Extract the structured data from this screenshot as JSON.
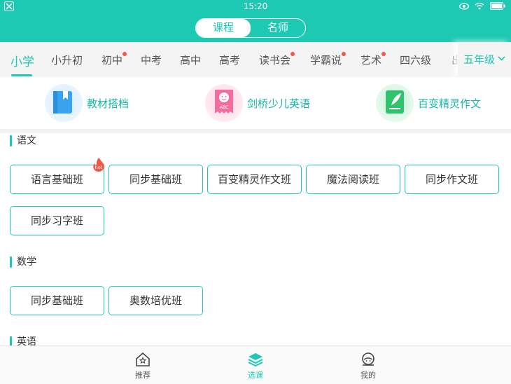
{
  "status": {
    "time": "15:20"
  },
  "header": {
    "segments": [
      {
        "label": "课程",
        "active": true
      },
      {
        "label": "名师",
        "active": false
      }
    ]
  },
  "levels": {
    "items": [
      {
        "label": "小学",
        "active": true,
        "dot": false
      },
      {
        "label": "小升初",
        "active": false,
        "dot": false
      },
      {
        "label": "初中",
        "active": false,
        "dot": true
      },
      {
        "label": "中考",
        "active": false,
        "dot": false
      },
      {
        "label": "高中",
        "active": false,
        "dot": false
      },
      {
        "label": "高考",
        "active": false,
        "dot": false
      },
      {
        "label": "读书会",
        "active": false,
        "dot": true
      },
      {
        "label": "学霸说",
        "active": false,
        "dot": true
      },
      {
        "label": "艺术",
        "active": false,
        "dot": true
      },
      {
        "label": "四六级",
        "active": false,
        "dot": false
      },
      {
        "label": "出",
        "active": false,
        "dot": false
      }
    ],
    "grade": "五年级"
  },
  "features": [
    {
      "label": "教材搭档",
      "icon": "book-icon"
    },
    {
      "label": "剑桥少儿英语",
      "icon": "abc-icon"
    },
    {
      "label": "百变精灵作文",
      "icon": "notebook-icon"
    }
  ],
  "sections": [
    {
      "title": "语文",
      "courses": [
        "语言基础班",
        "同步基础班",
        "百变精灵作文班",
        "魔法阅读班",
        "同步作文班",
        "同步习字班"
      ],
      "hot_badge": "hot"
    },
    {
      "title": "数学",
      "courses": [
        "同步基础班",
        "奥数培优班"
      ]
    },
    {
      "title": "英语"
    }
  ],
  "bottom_nav": [
    {
      "label": "推荐",
      "active": false
    },
    {
      "label": "选课",
      "active": true
    },
    {
      "label": "我的",
      "active": false
    }
  ],
  "colors": {
    "accent": "#1ec9b4",
    "dot": "#f0584a"
  }
}
